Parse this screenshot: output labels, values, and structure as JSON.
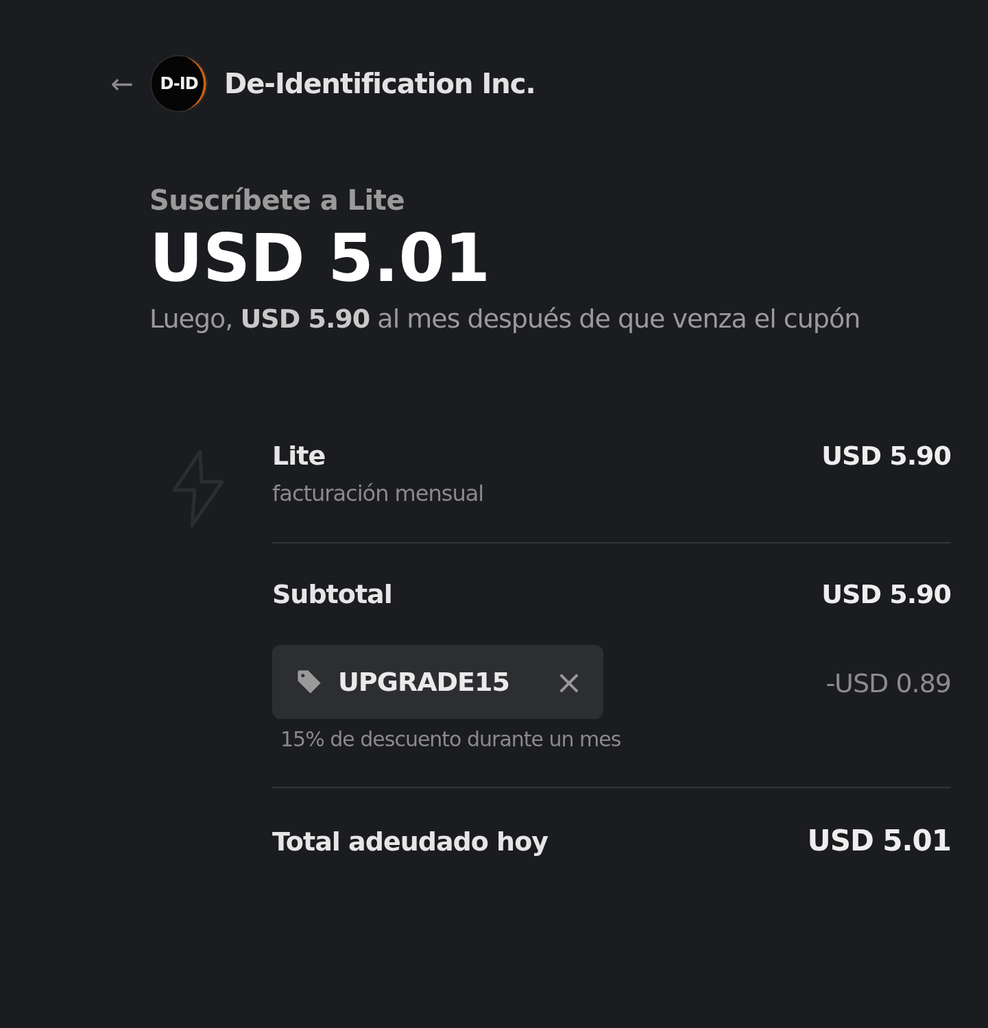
{
  "header": {
    "back_label": "←",
    "logo_text": "D-ID",
    "company": "De-Identification Inc."
  },
  "summary": {
    "title": "Suscríbete a Lite",
    "price": "USD 5.01",
    "note": "Luego, **USD 5.90** al mes después de que venza el cupón"
  },
  "line_items": [
    {
      "name": "Lite",
      "detail": "facturación mensual",
      "amount": "USD 5.90"
    }
  ],
  "subtotal": {
    "label": "Subtotal",
    "amount": "USD 5.90"
  },
  "coupon": {
    "code": "UPGRADE15",
    "remove_label": "×",
    "amount": "-USD 0.89",
    "description": "15% de descuento durante un mes"
  },
  "total": {
    "label": "Total adeudado hoy",
    "amount": "USD 5.01"
  }
}
